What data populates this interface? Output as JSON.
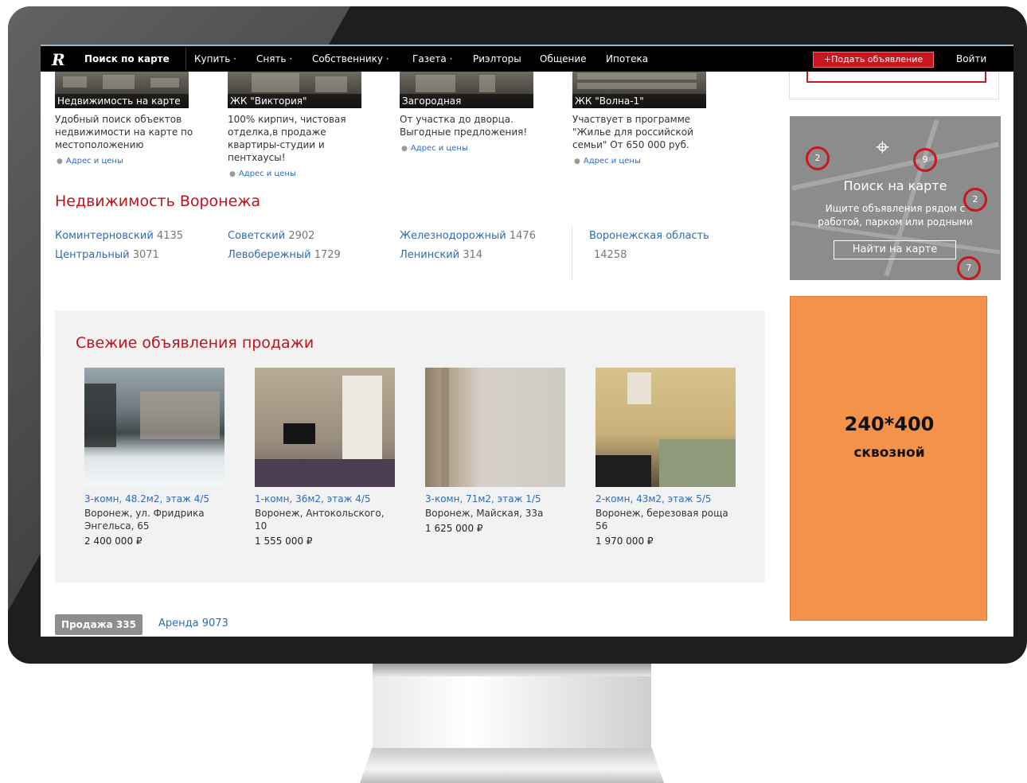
{
  "nav": {
    "map_search": "Поиск по карте",
    "items": [
      "Купить ·",
      "Снять ·",
      "Собственнику ·",
      "Газета ·",
      "Риэлторы",
      "Общение",
      "Ипотека"
    ],
    "post_ad": "+Подать объявление",
    "login": "Войти"
  },
  "categories": [
    {
      "caption": "Недвижимость на карте",
      "desc": "Удобный поиск объектов недвижимости на карте по местоположению",
      "link": "Адрес и цены"
    },
    {
      "caption": "ЖК \"Виктория\"",
      "desc": "100% кирпич, чистовая отделка,в продаже квартиры-студии и пентхаусы!",
      "link": "Адрес и цены"
    },
    {
      "caption": "Загородная",
      "desc": "От участка до дворца. Выгодные предложения!",
      "link": "Адрес и цены"
    },
    {
      "caption": "ЖК \"Волна-1\"",
      "desc": "Участвует в программе \"Жилье для российской семьи\" От 650 000 руб.",
      "link": "Адрес и цены"
    }
  ],
  "districts_title": "Недвижимость Воронежа",
  "districts": [
    {
      "name": "Коминтерновский",
      "count": "4135"
    },
    {
      "name": "Центральный",
      "count": "3071"
    },
    {
      "name": "Советский",
      "count": "2902"
    },
    {
      "name": "Левобережный",
      "count": "1729"
    },
    {
      "name": "Железнодорожный",
      "count": "1476"
    },
    {
      "name": "Ленинский",
      "count": "314"
    }
  ],
  "region": {
    "name": "Воронежская область",
    "count": "14258"
  },
  "fresh": {
    "title": "Свежие объявления продажи",
    "listings": [
      {
        "title": "3-комн, 48.2м2, этаж 4/5",
        "address": "Воронеж, ул. Фридрика Энгельса, 65",
        "price": "2 400 000 ₽"
      },
      {
        "title": "1-комн, 36м2, этаж 4/5",
        "address": "Воронеж, Антокольского, 10",
        "price": "1 555 000 ₽"
      },
      {
        "title": "3-комн, 71м2, этаж 1/5",
        "address": "Воронеж, Майская, 33а",
        "price": "1 625 000 ₽"
      },
      {
        "title": "2-комн, 43м2, этаж 5/5",
        "address": "Воронеж, березовая роща 56",
        "price": "1 970 000 ₽"
      }
    ]
  },
  "tabs": {
    "sale": "Продажа 335",
    "rent": "Аренда 9073"
  },
  "map_widget": {
    "title": "Поиск на карте",
    "subtitle": "Ищите объявления рядом с работой, парком или родными",
    "button": "Найти на карте",
    "markers": [
      "2",
      "9",
      "2",
      "7"
    ]
  },
  "ad": {
    "size": "240*400",
    "type": "сквозной"
  }
}
